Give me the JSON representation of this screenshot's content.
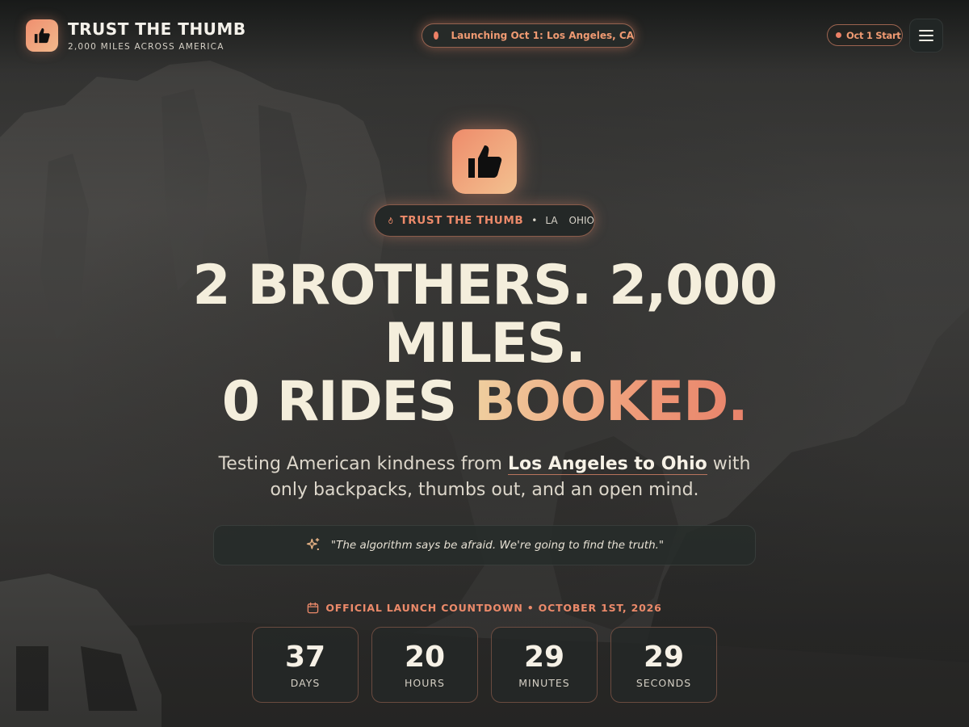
{
  "header": {
    "brand_title": "TRUST THE THUMB",
    "brand_subtitle": "2,000 MILES ACROSS AMERICA",
    "launch_text": "Launching Oct 1: Los Angeles, CA",
    "start_text": "Oct 1 Start",
    "brand_logo_icon": "thumbs-up-icon",
    "menu_icon": "hamburger-menu-icon"
  },
  "hero": {
    "icon": "thumbs-up-icon",
    "tag": {
      "title": "TRUST THE THUMB",
      "icon": "flame-icon",
      "separator": "•",
      "from": "LA",
      "to": "OHIO"
    },
    "headline": {
      "line1": "2 BROTHERS. 2,000",
      "line2": "MILES.",
      "line3_plain": "0 RIDES ",
      "line3_accent": "BOOKED."
    },
    "subtitle": {
      "before": "Testing American kindness from ",
      "strong": "Los Angeles to Ohio",
      "after": " with only backpacks, thumbs out, and an open mind."
    },
    "quote": {
      "icon": "sparkles-icon",
      "text": "\"The algorithm says be afraid. We're going to find the truth.\""
    }
  },
  "countdown": {
    "label": "OFFICIAL LAUNCH COUNTDOWN • OCTOBER 1ST, 2026",
    "icon": "calendar-icon",
    "units": [
      {
        "value": "37",
        "label": "DAYS"
      },
      {
        "value": "20",
        "label": "HOURS"
      },
      {
        "value": "29",
        "label": "MINUTES"
      },
      {
        "value": "29",
        "label": "SECONDS"
      }
    ]
  },
  "colors": {
    "accent": "#ec8a6a",
    "accent_light": "#f2b98c",
    "text": "#f4eedc"
  }
}
